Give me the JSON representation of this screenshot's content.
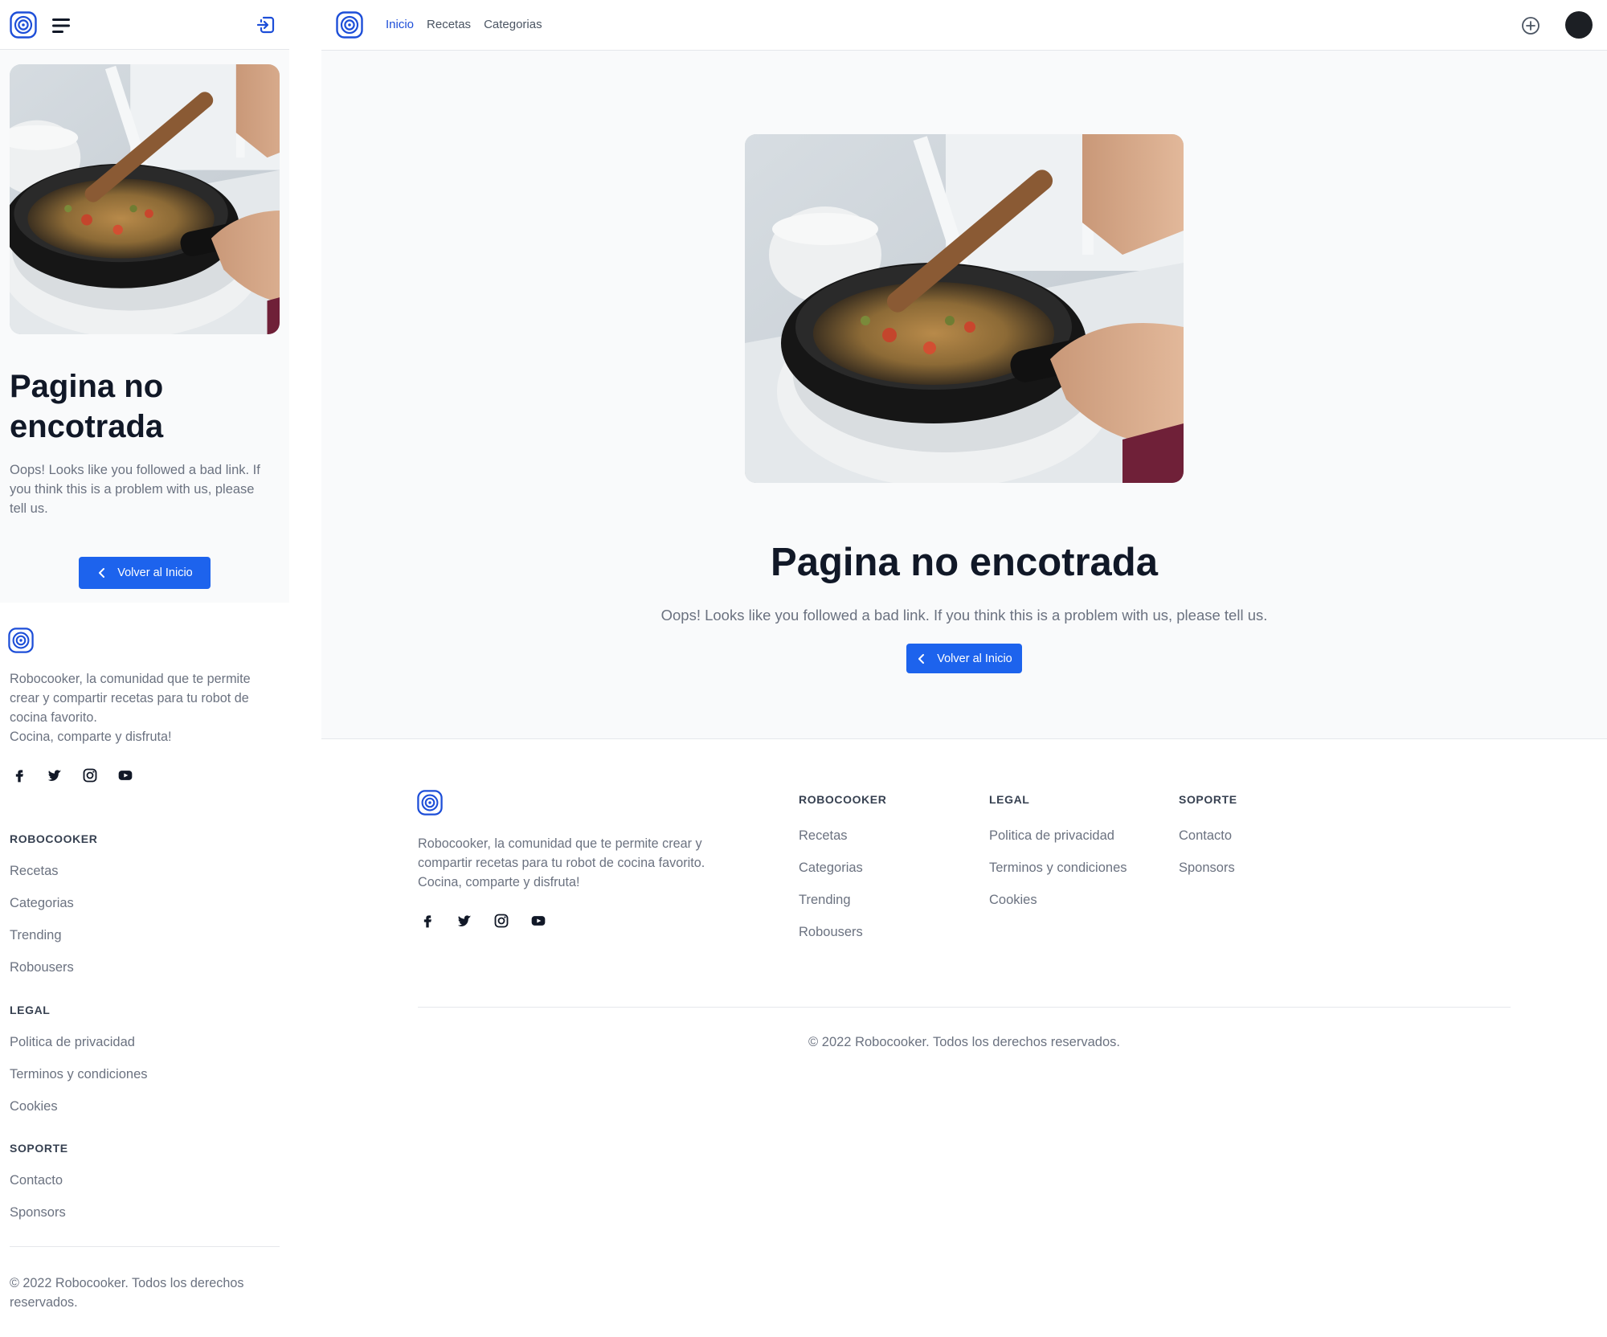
{
  "brand": {
    "name": "Robocooker",
    "color": "#1d4ed8",
    "button_color": "#1d63ed"
  },
  "topbar": {
    "nav": [
      {
        "label": "Inicio",
        "active": true
      },
      {
        "label": "Recetas",
        "active": false
      },
      {
        "label": "Categorias",
        "active": false
      }
    ],
    "icons": [
      "logo-icon",
      "menu-icon",
      "login-icon",
      "add-circle-icon",
      "avatar"
    ]
  },
  "error": {
    "title": "Pagina no encotrada",
    "title_line1": "Pagina no",
    "title_line2": "encotrada",
    "message": "Oops! Looks like you followed a bad link. If you think this is a problem with us, please tell us.",
    "message_mobile_lines": [
      "Oops! Looks like you followed a bad link. If",
      "you think this is a problem with us, please",
      "tell us."
    ],
    "button_label": "Volver al Inicio"
  },
  "footer": {
    "about_mobile_lines": [
      "Robocooker, la comunidad que te permite",
      "crear y compartir recetas para tu robot de",
      "cocina favorito.",
      "Cocina, comparte y disfruta!"
    ],
    "about_desktop_lines": [
      "Robocooker, la comunidad que te permite crear y",
      "compartir recetas para tu robot de cocina favorito.",
      "Cocina, comparte y disfruta!"
    ],
    "social": [
      "facebook-icon",
      "twitter-icon",
      "instagram-icon",
      "youtube-icon"
    ],
    "sections": [
      {
        "title": "ROBOCOOKER",
        "links": [
          "Recetas",
          "Categorias",
          "Trending",
          "Robousers"
        ]
      },
      {
        "title": "LEGAL",
        "links": [
          "Politica de privacidad",
          "Terminos y condiciones",
          "Cookies"
        ]
      },
      {
        "title": "SOPORTE",
        "links": [
          "Contacto",
          "Sponsors"
        ]
      }
    ],
    "copyright": "© 2022 Robocooker. Todos los derechos reservados.",
    "copyright_mobile_lines": [
      "© 2022 Robocooker. Todos los derechos",
      "reservados."
    ]
  }
}
